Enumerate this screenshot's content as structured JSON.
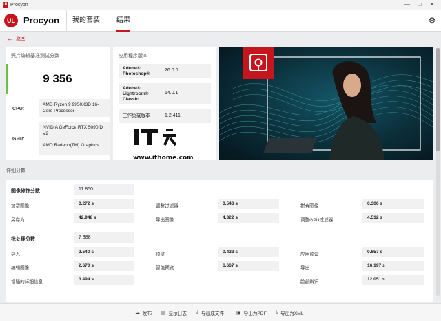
{
  "window": {
    "title": "Procyon",
    "icon_text": "UL"
  },
  "header": {
    "logo_text": "UL",
    "app_name": "Procyon",
    "tabs": [
      {
        "label": "我的套装",
        "active": false
      },
      {
        "label": "结果",
        "active": true
      }
    ]
  },
  "back_label": "返回",
  "score_card": {
    "title": "照片编辑基准测试分数",
    "score": "9 356",
    "cpu_label": "CPU:",
    "cpu_value": "AMD Ryzen 9 9950X3D 16-Core Processor",
    "gpu_label": "GPU:",
    "gpu_value_1": "NVIDIA GeForce RTX 5090 D V2",
    "gpu_value_2": "AMD Radeon(TM) Graphics"
  },
  "versions_card": {
    "title": "应用程序版本",
    "rows": [
      {
        "name": "Adobe® Photoshop®",
        "value": "26.0.0"
      },
      {
        "name": "Adobe® Lightroom® Classic",
        "value": "14.0.1"
      },
      {
        "name": "工作负载版本",
        "value": "1.2.411"
      }
    ]
  },
  "watermark": {
    "logo_text": "IT之家",
    "url": "www.ithome.com"
  },
  "details": {
    "title": "详细分数",
    "groups": [
      {
        "label": "图像修饰分数",
        "score": "11 850",
        "metrics": [
          {
            "label": "加载图像",
            "value": "0.272 s"
          },
          {
            "label": "调整过滤器",
            "value": "0.543 s"
          },
          {
            "label": "拼合图像",
            "value": "0.306 s"
          },
          {
            "label": "另存为",
            "value": "42.948 s"
          },
          {
            "label": "导出图像",
            "value": "4.322 s"
          },
          {
            "label": "调整GPU过滤器",
            "value": "4.512 s"
          }
        ]
      },
      {
        "label": "批处理分数",
        "score": "7 388",
        "metrics": [
          {
            "label": "导入",
            "value": "2.540 s"
          },
          {
            "label": "预览",
            "value": "0.423 s"
          },
          {
            "label": "应用预设",
            "value": "0.657 s"
          },
          {
            "label": "编辑图像",
            "value": "2.670 s"
          },
          {
            "label": "智能预览",
            "value": "6.667 s"
          },
          {
            "label": "导出",
            "value": "16.197 s"
          },
          {
            "label": "增强的详细信息",
            "value": "3.494 s"
          },
          {
            "label": "",
            "value": ""
          },
          {
            "label": "脸部辨识",
            "value": "12.051 s"
          }
        ]
      }
    ]
  },
  "footer": {
    "buttons": [
      {
        "label": "发布",
        "icon": "cloud-upload-icon"
      },
      {
        "label": "显示日志",
        "icon": "document-icon"
      },
      {
        "label": "导出成文件",
        "icon": "download-icon"
      },
      {
        "label": "导出为PDF",
        "icon": "save-icon"
      },
      {
        "label": "导出为XML",
        "icon": "download-icon"
      }
    ]
  },
  "colors": {
    "accent": "#c4161c",
    "score_bar": "#6bbf43"
  }
}
